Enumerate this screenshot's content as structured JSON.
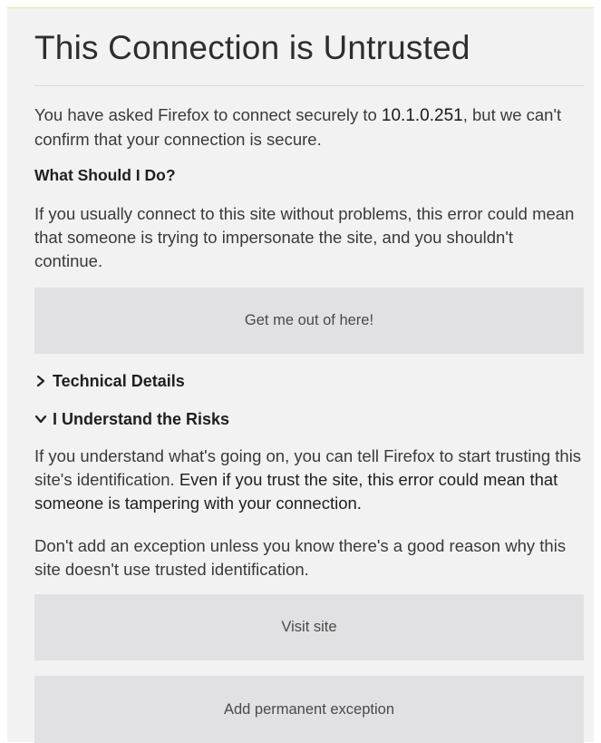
{
  "page": {
    "title": "This Connection is Untrusted"
  },
  "intro": {
    "before_host": "You have asked Firefox to connect securely to ",
    "host": "10.1.0.251",
    "after_host": ", but we can't confirm that your connection is secure."
  },
  "what_to_do": {
    "heading": "What Should I Do?",
    "body": "If you usually connect to this site without problems, this error could mean that someone is trying to impersonate the site, and you shouldn't continue."
  },
  "buttons": {
    "get_out": "Get me out of here!",
    "visit_site": "Visit site",
    "add_exception": "Add permanent exception"
  },
  "technical_details": {
    "label": "Technical Details",
    "icon": "chevron-right-icon"
  },
  "risks": {
    "label": "I Understand the Risks",
    "icon": "chevron-down-icon",
    "body_1a": "If you understand what's going on, you can tell Firefox to start trusting this site's identification. ",
    "body_1b": "Even if you trust the site, this error could mean that someone is tampering with your connection.",
    "body_2": "Don't add an exception unless you know there's a good reason why this site doesn't use trusted identification."
  }
}
